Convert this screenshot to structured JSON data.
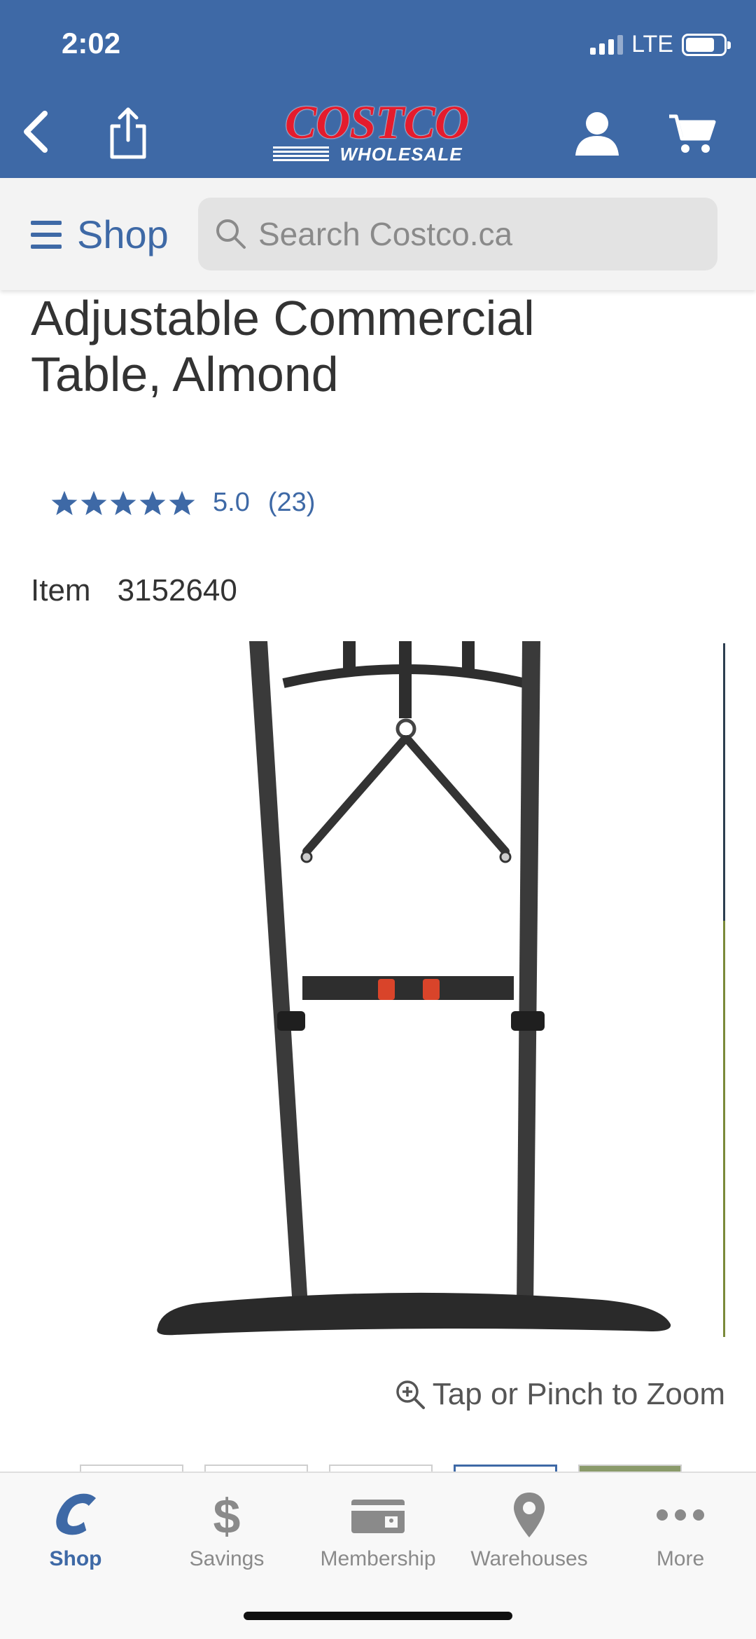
{
  "status_bar": {
    "time": "2:02",
    "network": "LTE"
  },
  "header": {
    "logo_main": "COSTCO",
    "logo_sub": "WHOLESALE",
    "icons": [
      "back-icon",
      "share-icon",
      "account-icon",
      "cart-icon"
    ],
    "brand_color": "#3e69a6",
    "logo_color": "#e41c2d"
  },
  "search": {
    "shop_label": "Shop",
    "placeholder": "Search Costco.ca"
  },
  "product": {
    "title": "Adjustable Commercial Table, Almond",
    "rating_value": "5.0",
    "rating_count": "(23)",
    "stars": 5,
    "item_label": "Item",
    "item_number": "3152640"
  },
  "gallery": {
    "zoom_hint": "Tap or Pinch to Zoom",
    "thumbnail_count": 5,
    "active_thumbnail": 4
  },
  "tab_bar": {
    "tabs": [
      {
        "label": "Shop",
        "icon": "costco-c-icon",
        "active": true
      },
      {
        "label": "Savings",
        "icon": "dollar-icon",
        "active": false
      },
      {
        "label": "Membership",
        "icon": "membership-card-icon",
        "active": false
      },
      {
        "label": "Warehouses",
        "icon": "location-pin-icon",
        "active": false
      },
      {
        "label": "More",
        "icon": "more-dots-icon",
        "active": false
      }
    ]
  }
}
